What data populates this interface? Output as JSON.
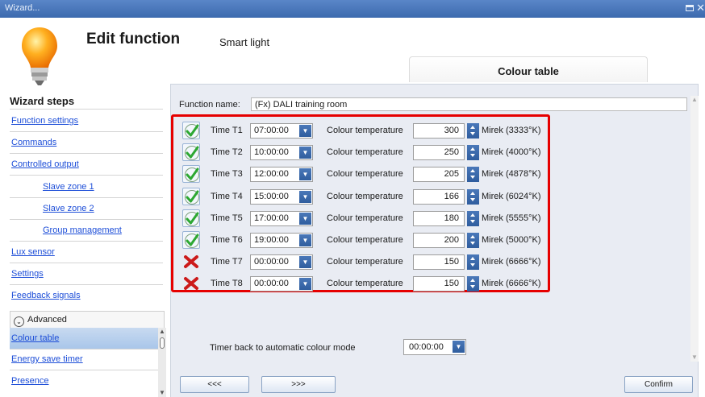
{
  "window": {
    "title": "Wizard..."
  },
  "header": {
    "title": "Edit function",
    "subtitle": "Smart light",
    "tab": "Colour table"
  },
  "sidebar": {
    "title": "Wizard steps",
    "items": [
      {
        "label": "Function settings"
      },
      {
        "label": "Commands"
      },
      {
        "label": "Controlled output"
      },
      {
        "label": "Slave zone 1"
      },
      {
        "label": "Slave zone 2"
      },
      {
        "label": "Group management"
      },
      {
        "label": "Lux sensor"
      },
      {
        "label": "Settings"
      },
      {
        "label": "Feedback signals"
      }
    ],
    "advanced": "Advanced",
    "advanced_items": [
      {
        "label": "Colour table"
      },
      {
        "label": "Energy save timer"
      },
      {
        "label": "Presence"
      }
    ]
  },
  "form": {
    "function_name_label": "Function name:",
    "function_name_value": "(Fx) DALI training room",
    "ct_label": "Colour temperature",
    "rows": [
      {
        "enabled": true,
        "label": "Time T1",
        "time": "07:00:00",
        "value": "300",
        "unit": "Mirek (3333°K)"
      },
      {
        "enabled": true,
        "label": "Time T2",
        "time": "10:00:00",
        "value": "250",
        "unit": "Mirek (4000°K)"
      },
      {
        "enabled": true,
        "label": "Time T3",
        "time": "12:00:00",
        "value": "205",
        "unit": "Mirek (4878°K)"
      },
      {
        "enabled": true,
        "label": "Time T4",
        "time": "15:00:00",
        "value": "166",
        "unit": "Mirek (6024°K)"
      },
      {
        "enabled": true,
        "label": "Time T5",
        "time": "17:00:00",
        "value": "180",
        "unit": "Mirek (5555°K)"
      },
      {
        "enabled": true,
        "label": "Time T6",
        "time": "19:00:00",
        "value": "200",
        "unit": "Mirek (5000°K)"
      },
      {
        "enabled": false,
        "label": "Time T7",
        "time": "00:00:00",
        "value": "150",
        "unit": "Mirek (6666°K)"
      },
      {
        "enabled": false,
        "label": "Time T8",
        "time": "00:00:00",
        "value": "150",
        "unit": "Mirek (6666°K)"
      }
    ],
    "timer_back_label": "Timer back to automatic colour mode",
    "timer_back_value": "00:00:00"
  },
  "footer": {
    "prev": "<<<",
    "next": ">>>",
    "confirm": "Confirm"
  },
  "colors": {
    "highlight": "#e60000",
    "accent": "#2f5d9e",
    "check": "#2da832",
    "cross": "#cc1a1a"
  }
}
